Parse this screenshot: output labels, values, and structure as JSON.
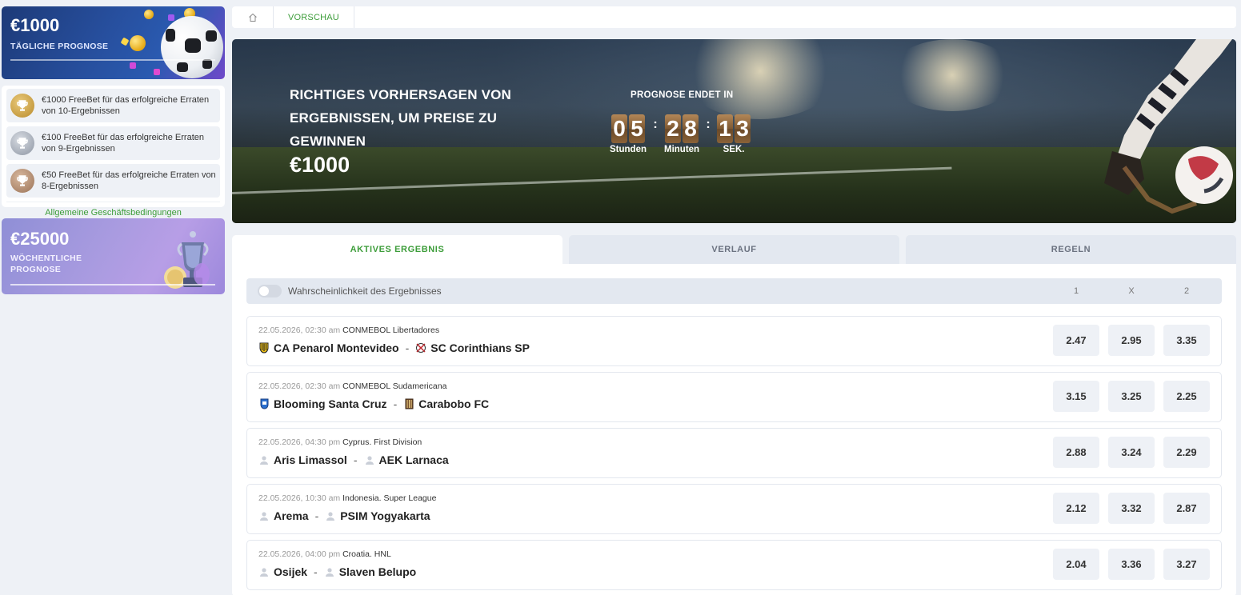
{
  "sidebar": {
    "daily": {
      "amount": "€1000",
      "label": "TÄGLICHE PROGNOSE"
    },
    "prizes": [
      {
        "text": "€1000 FreeBet für das erfolgreiche Erraten von 10-Ergebnissen",
        "tier": "gold"
      },
      {
        "text": "€100 FreeBet für das erfolgreiche Erraten von 9-Ergebnissen",
        "tier": "silver"
      },
      {
        "text": "€50 FreeBet für das erfolgreiche Erraten von 8-Ergebnissen",
        "tier": "bronze"
      }
    ],
    "terms_link": "Allgemeine Geschäftsbedingungen",
    "weekly": {
      "amount": "€25000",
      "label_line1": "WÖCHENTLICHE",
      "label_line2": "PROGNOSE"
    }
  },
  "breadcrumb": {
    "home_icon": "home-icon",
    "current": "VORSCHAU"
  },
  "hero": {
    "title": "RICHTIGES VORHERSAGEN VON ERGEBNISSEN, UM PREISE ZU GEWINNEN",
    "prize": "€1000",
    "countdown_label": "PROGNOSE ENDET IN",
    "countdown": {
      "hours": [
        "0",
        "5"
      ],
      "minutes": [
        "2",
        "8"
      ],
      "seconds": [
        "1",
        "3"
      ],
      "hours_label": "Stunden",
      "minutes_label": "Minuten",
      "seconds_label": "SEK."
    }
  },
  "tabs": [
    {
      "label": "AKTIVES ERGEBNIS",
      "active": true
    },
    {
      "label": "VERLAUF",
      "active": false
    },
    {
      "label": "REGELN",
      "active": false
    }
  ],
  "filter": {
    "label": "Wahrscheinlichkeit des Ergebnisses",
    "col1": "1",
    "colx": "X",
    "col2": "2"
  },
  "matches": [
    {
      "datetime": "22.05.2026, 02:30 am",
      "league": "CONMEBOL Libertadores",
      "home": "CA Penarol Montevideo",
      "away": "SC Corinthians SP",
      "odds": [
        "2.47",
        "2.95",
        "3.35"
      ]
    },
    {
      "datetime": "22.05.2026, 02:30 am",
      "league": "CONMEBOL Sudamericana",
      "home": "Blooming Santa Cruz",
      "away": "Carabobo FC",
      "odds": [
        "3.15",
        "3.25",
        "2.25"
      ]
    },
    {
      "datetime": "22.05.2026, 04:30 pm",
      "league": "Cyprus. First Division",
      "home": "Aris Limassol",
      "away": "AEK Larnaca",
      "odds": [
        "2.88",
        "3.24",
        "2.29"
      ]
    },
    {
      "datetime": "22.05.2026, 10:30 am",
      "league": "Indonesia. Super League",
      "home": "Arema",
      "away": "PSIM Yogyakarta",
      "odds": [
        "2.12",
        "3.32",
        "2.87"
      ]
    },
    {
      "datetime": "22.05.2026, 04:00 pm",
      "league": "Croatia. HNL",
      "home": "Osijek",
      "away": "Slaven Belupo",
      "odds": [
        "2.04",
        "3.36",
        "3.27"
      ]
    }
  ],
  "colors": {
    "accent": "#3d9d3a",
    "background": "#eef1f6"
  }
}
